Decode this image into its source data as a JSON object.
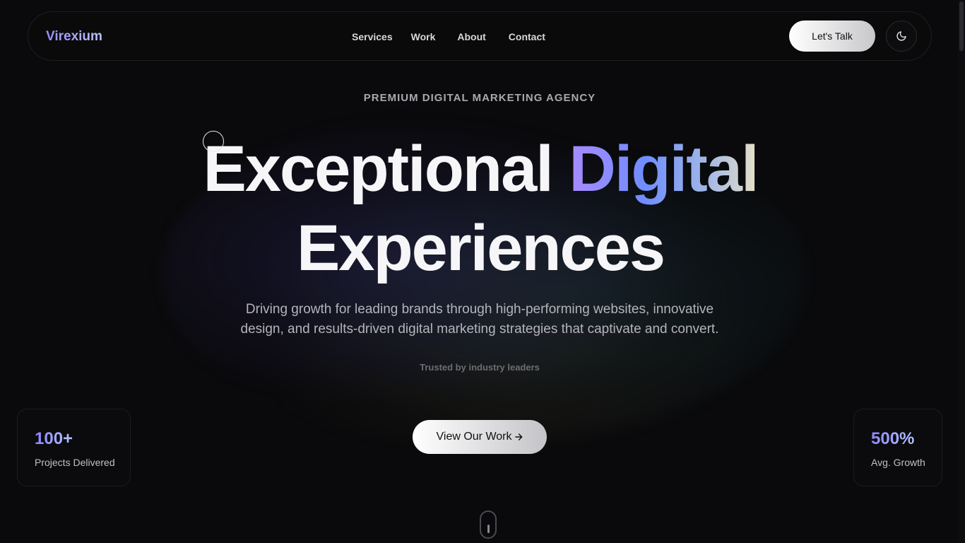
{
  "nav": {
    "brand": "Virexium",
    "links": [
      "Services",
      "Work",
      "About",
      "Contact"
    ],
    "cta_label": "Let's Talk",
    "theme_icon": "moon-icon"
  },
  "hero": {
    "eyebrow": "PREMIUM DIGITAL MARKETING AGENCY",
    "headline_part1": "Exceptional ",
    "headline_highlight": "Digital",
    "headline_line2": "Experiences",
    "subtitle_line1": "Driving growth for leading brands through high-performing websites, innovative",
    "subtitle_line2": "design, and results-driven digital marketing strategies that captivate and convert.",
    "trusted": "Trusted by industry leaders",
    "cta_label": "View Our Work",
    "cta_icon": "arrow-right-icon"
  },
  "stats": [
    {
      "value": "100+",
      "label": "Projects Delivered"
    },
    {
      "value": "500%",
      "label": "Avg. Growth"
    }
  ],
  "colors": {
    "background": "#0a0a0c",
    "brand_gradient_start": "#9b8cff",
    "highlight_gradient": [
      "#a98bff",
      "#6f8dff",
      "#9cb3e8",
      "#e8e1c8"
    ]
  }
}
